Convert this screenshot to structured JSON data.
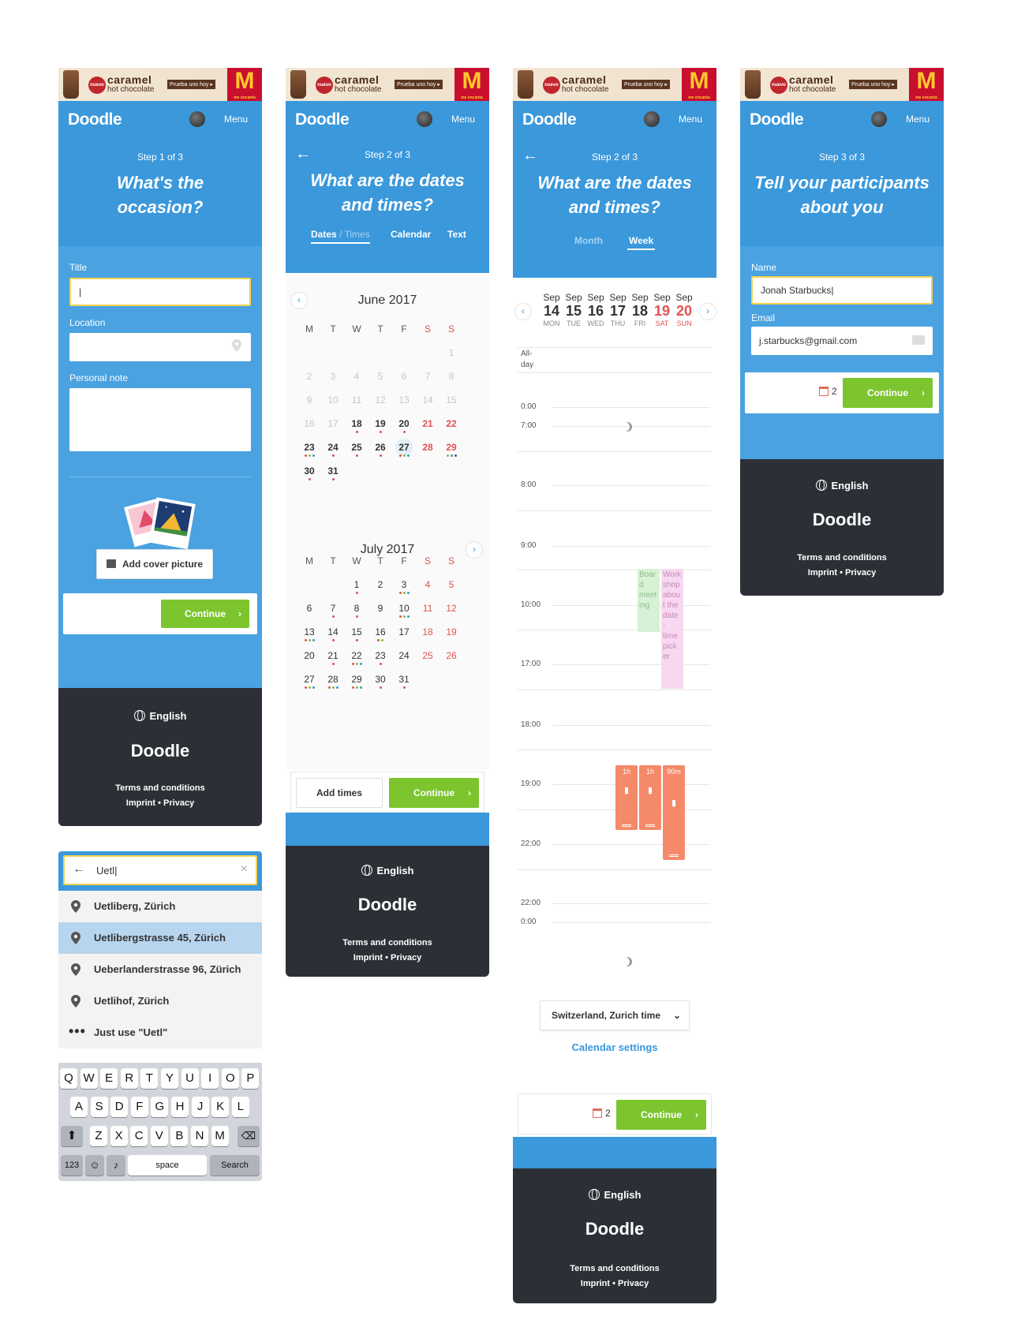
{
  "ad": {
    "nuevo": "nuevo",
    "caramel": "caramel",
    "hot": "hot chocolate",
    "prueba": "Prueba uno hoy ▸",
    "logo": "M",
    "tag": "me encanta"
  },
  "brand": {
    "logo": "Doodle",
    "menu": "Menu"
  },
  "colors": {
    "primary": "#3a98db",
    "green": "#7dc52e",
    "footer": "#2c3036",
    "weekend": "#e05252",
    "slot": "#f58a6a"
  },
  "screen1": {
    "step": "Step 1 of 3",
    "title_l1": "What's the",
    "title_l2": "occasion?",
    "title_label": "Title",
    "title_value": "|",
    "location_label": "Location",
    "note_label": "Personal note",
    "cover_button": "Add cover picture",
    "continue": "Continue"
  },
  "screen2": {
    "step": "Step 2 of 3",
    "title_l1": "What are the dates",
    "title_l2": "and times?",
    "tabs": {
      "dates": "Dates",
      "sep": " / ",
      "times": "Times",
      "calendar": "Calendar",
      "text": "Text"
    },
    "weekdays": [
      "M",
      "T",
      "W",
      "T",
      "F",
      "S",
      "S"
    ],
    "june": {
      "title": "June 2017",
      "weeks": [
        [
          "",
          "",
          "",
          "",
          "",
          "",
          "1"
        ],
        [
          "2",
          "3",
          "4",
          "5",
          "6",
          "7",
          "8"
        ],
        [
          "9",
          "10",
          "11",
          "12",
          "13",
          "14",
          "15"
        ],
        [
          "16",
          "17",
          "18",
          "19",
          "20",
          "21",
          "22"
        ],
        [
          "23",
          "24",
          "25",
          "26",
          "27",
          "28",
          "29"
        ],
        [
          "30",
          "31",
          "",
          "",
          "",
          "",
          ""
        ]
      ]
    },
    "july": {
      "title": "July 2017",
      "weeks": [
        [
          "",
          "",
          "1",
          "2",
          "3",
          "4",
          "5"
        ],
        [
          "6",
          "7",
          "8",
          "9",
          "10",
          "11",
          "12"
        ],
        [
          "13",
          "14",
          "15",
          "16",
          "17",
          "18",
          "19"
        ],
        [
          "20",
          "21",
          "22",
          "23",
          "24",
          "25",
          "26"
        ],
        [
          "27",
          "28",
          "29",
          "30",
          "31",
          "",
          ""
        ]
      ]
    },
    "add_times": "Add times",
    "continue": "Continue"
  },
  "screen3": {
    "step": "Step 2 of 3",
    "title_l1": "What are the dates",
    "title_l2": "and times?",
    "tabs": {
      "month": "Month",
      "week": "Week"
    },
    "days": [
      {
        "mon": "Sep",
        "num": "14",
        "dow": "MON"
      },
      {
        "mon": "Sep",
        "num": "15",
        "dow": "TUE"
      },
      {
        "mon": "Sep",
        "num": "16",
        "dow": "WED"
      },
      {
        "mon": "Sep",
        "num": "17",
        "dow": "THU"
      },
      {
        "mon": "Sep",
        "num": "18",
        "dow": "FRI"
      },
      {
        "mon": "Sep",
        "num": "19",
        "dow": "SAT"
      },
      {
        "mon": "Sep",
        "num": "20",
        "dow": "SUN"
      }
    ],
    "allday": "All-\nday",
    "times": [
      "0:00",
      "7:00",
      "8:00",
      "9:00",
      "10:00",
      "17:00",
      "18:00",
      "19:00",
      "22:00",
      "22:00",
      "0:00"
    ],
    "event1": "Boar d meet ing",
    "event2": "Work shop abou t the date - time pick er",
    "slot_1": "1h",
    "slot_2": "1h",
    "slot_3": "90m",
    "timezone": "Switzerland, Zurich time",
    "calendar_settings": "Calendar settings",
    "count": "2",
    "continue": "Continue"
  },
  "screen4": {
    "step": "Step 3 of 3",
    "title_l1": "Tell your participants",
    "title_l2": "about you",
    "name_label": "Name",
    "name_value": "Jonah Starbucks|",
    "email_label": "Email",
    "email_value": "j.starbucks@gmail.com",
    "count": "2",
    "continue": "Continue"
  },
  "footer": {
    "language": "English",
    "logo": "Doodle",
    "terms": "Terms and conditions",
    "imprint": "Imprint",
    "dot": "•",
    "privacy": "Privacy"
  },
  "screen5": {
    "search_value": "Uetl|",
    "suggestions": [
      "Uetliberg, Zürich",
      "Uetlibergstrasse 45, Zürich",
      "Ueberlanderstrasse 96, Zürich",
      "Uetlihof, Zürich"
    ],
    "just_use": "Just use \"Uetl\"",
    "keyboard": {
      "row1": [
        "Q",
        "W",
        "E",
        "R",
        "T",
        "Y",
        "U",
        "I",
        "O",
        "P"
      ],
      "row2": [
        "A",
        "S",
        "D",
        "F",
        "G",
        "H",
        "J",
        "K",
        "L"
      ],
      "row3": [
        "Z",
        "X",
        "C",
        "V",
        "B",
        "N",
        "M"
      ],
      "num": "123",
      "space": "space",
      "search": "Search"
    }
  }
}
